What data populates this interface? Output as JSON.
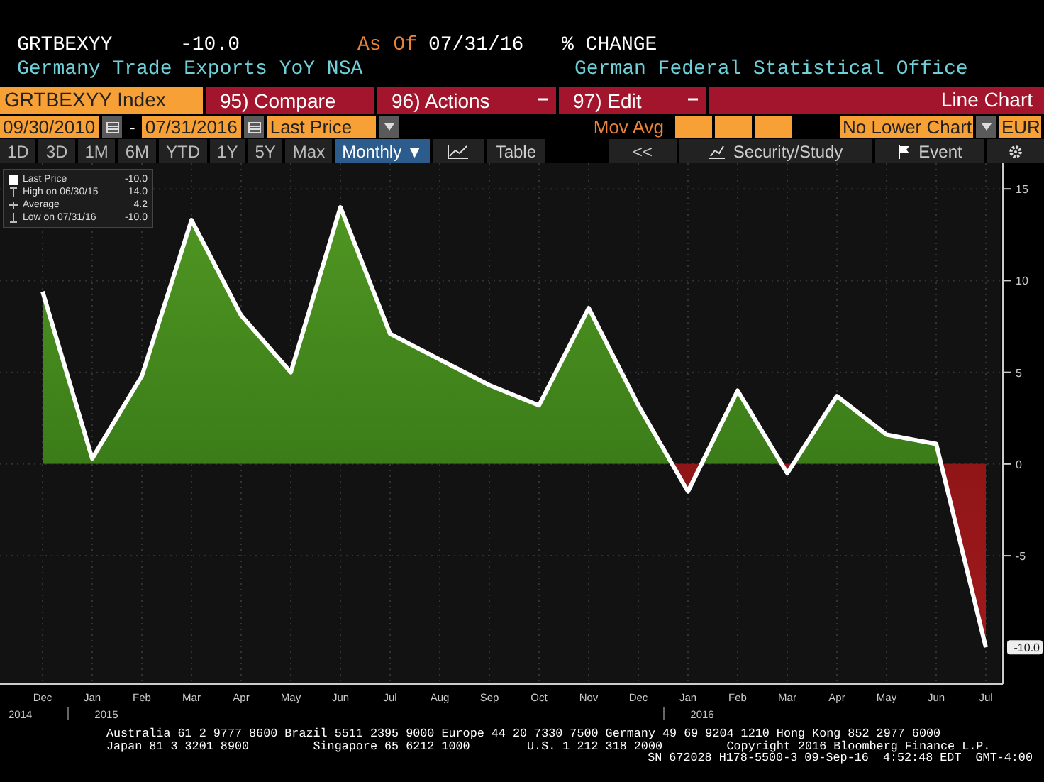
{
  "header": {
    "ticker": "GRTBEXYY",
    "value": "-10.0",
    "as_of_label": "As Of",
    "as_of_date": "07/31/16",
    "units": "% CHANGE",
    "description": "Germany Trade Exports YoY NSA",
    "source": "German Federal Statistical Office"
  },
  "command_bar": {
    "security": "GRTBEXYY Index",
    "buttons": [
      {
        "number": "95)",
        "label": "Compare",
        "dropdown": false
      },
      {
        "number": "96)",
        "label": "Actions",
        "dropdown": true
      },
      {
        "number": "97)",
        "label": "Edit",
        "dropdown": true
      }
    ],
    "chart_type": "Line Chart"
  },
  "settings_bar": {
    "start_date": "09/30/2010",
    "separator": "-",
    "end_date": "07/31/2016",
    "field": "Last Price",
    "mov_avg_label": "Mov Avg",
    "lower_chart": "No Lower Chart",
    "currency": "EUR"
  },
  "period_bar": {
    "periods": [
      {
        "label": "1D",
        "selected": false
      },
      {
        "label": "3D",
        "selected": false
      },
      {
        "label": "1M",
        "selected": false
      },
      {
        "label": "6M",
        "selected": false
      },
      {
        "label": "YTD",
        "selected": false
      },
      {
        "label": "1Y",
        "selected": false
      },
      {
        "label": "5Y",
        "selected": false
      },
      {
        "label": "Max",
        "selected": false
      },
      {
        "label": "Monthly ▼",
        "selected": true
      }
    ],
    "table": "Table",
    "back": "<<",
    "study": "Security/Study",
    "event": "Event"
  },
  "legend": [
    {
      "kind": "last",
      "value": "-10.0"
    },
    {
      "kind": "high",
      "label": "High on 06/30/15",
      "value": "14.0"
    },
    {
      "kind": "average",
      "label": "Average",
      "value": "4.2"
    },
    {
      "kind": "low",
      "label": "Low on 07/31/16",
      "value": "-10.0"
    }
  ],
  "chart": {
    "chart_data": {
      "type": "area",
      "categories": [
        "Dec",
        "Jan",
        "Feb",
        "Mar",
        "Apr",
        "May",
        "Jun",
        "Jul",
        "Aug",
        "Sep",
        "Oct",
        "Nov",
        "Dec",
        "Jan",
        "Feb",
        "Mar",
        "Apr",
        "May",
        "Jun",
        "Jul"
      ],
      "series": [
        {
          "name": "Last Price",
          "color": "#ffffff",
          "values": [
            9.4,
            0.3,
            4.8,
            13.3,
            8.1,
            5.0,
            14.0,
            7.1,
            5.7,
            4.3,
            3.2,
            8.5,
            3.2,
            -1.5,
            4.0,
            -0.5,
            3.7,
            1.6,
            1.1,
            -10.0
          ]
        }
      ],
      "ylim": [
        -12,
        16.4
      ],
      "grid": true,
      "yticks": [
        -5,
        0,
        5,
        10,
        15
      ],
      "value_labels": [
        "-10.0"
      ]
    },
    "year_labels": [
      "2014",
      "2015",
      "2016"
    ]
  },
  "footer": [
    "Australia 61 2 9777 8600 Brazil 5511 2395 9000 Europe 44 20 7330 7500 Germany 49 69 9204 1210 Hong Kong 852 2977 6000",
    "Japan 81 3 3201 8900         Singapore 65 6212 1000        U.S. 1 212 318 2000         Copyright 2016 Bloomberg Finance L.P.",
    "SN 672028 H178-5500-3 09-Sep-16  4:52:48 EDT  GMT-4:00"
  ]
}
